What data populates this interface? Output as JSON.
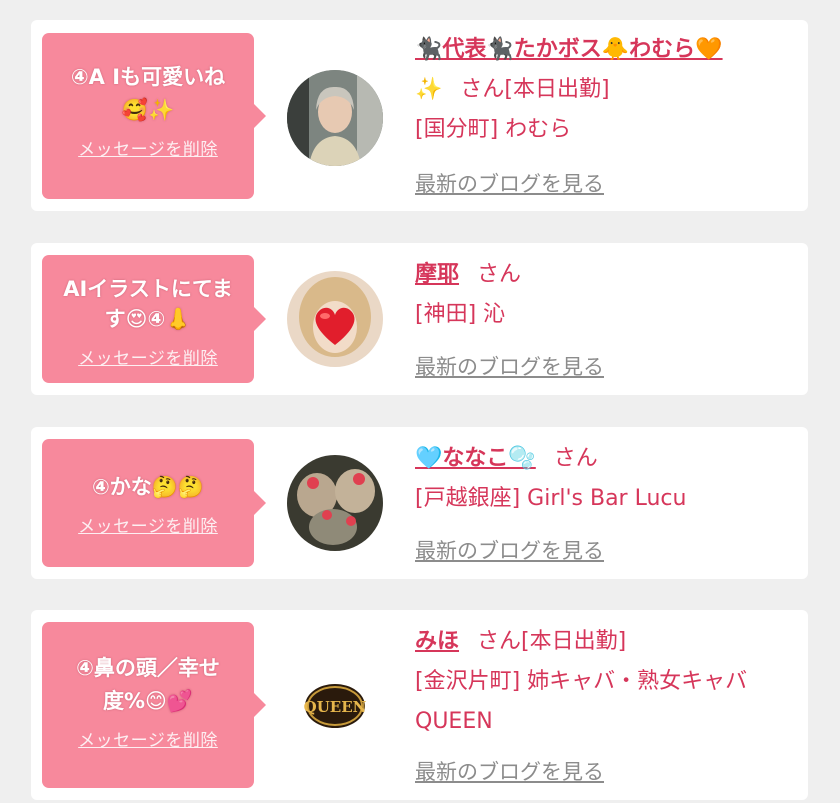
{
  "colors": {
    "bubble": "#f7899c",
    "accent": "#d6365a",
    "link_gray": "#8c8c8c",
    "background": "#efefef"
  },
  "delete_label": "メッセージを削除",
  "blog_label": "最新のブログを見る",
  "cards": [
    {
      "message_line1": "④A Iも可愛いね",
      "message_line2": "🥰✨",
      "name": "🐈‍⬛代表🐈‍⬛たかボス🐥わむら🧡",
      "name_cont": "✨",
      "san": "さん[本日出勤]",
      "shop": "[国分町] わむら",
      "shop2": ""
    },
    {
      "message_line1": "AIイラストにてま",
      "message_line2": "す😍④👃",
      "name": "摩耶",
      "san": "さん",
      "shop": "[神田] 沁",
      "shop2": ""
    },
    {
      "message_line1": "④かな🤔🤔",
      "message_line2": "",
      "name": "🩵ななこ🫧",
      "san": "さん",
      "shop": "[戸越銀座] Girl's Bar Lucu",
      "shop2": ""
    },
    {
      "message_line1": "④鼻の頭／幸せ",
      "message_line2": "度%😊💕",
      "name": "みほ",
      "san": "さん[本日出勤]",
      "shop": "[金沢片町] 姉キャバ・熟女キャバ",
      "shop2": "QUEEN",
      "logo_text": "QUEEN"
    }
  ]
}
